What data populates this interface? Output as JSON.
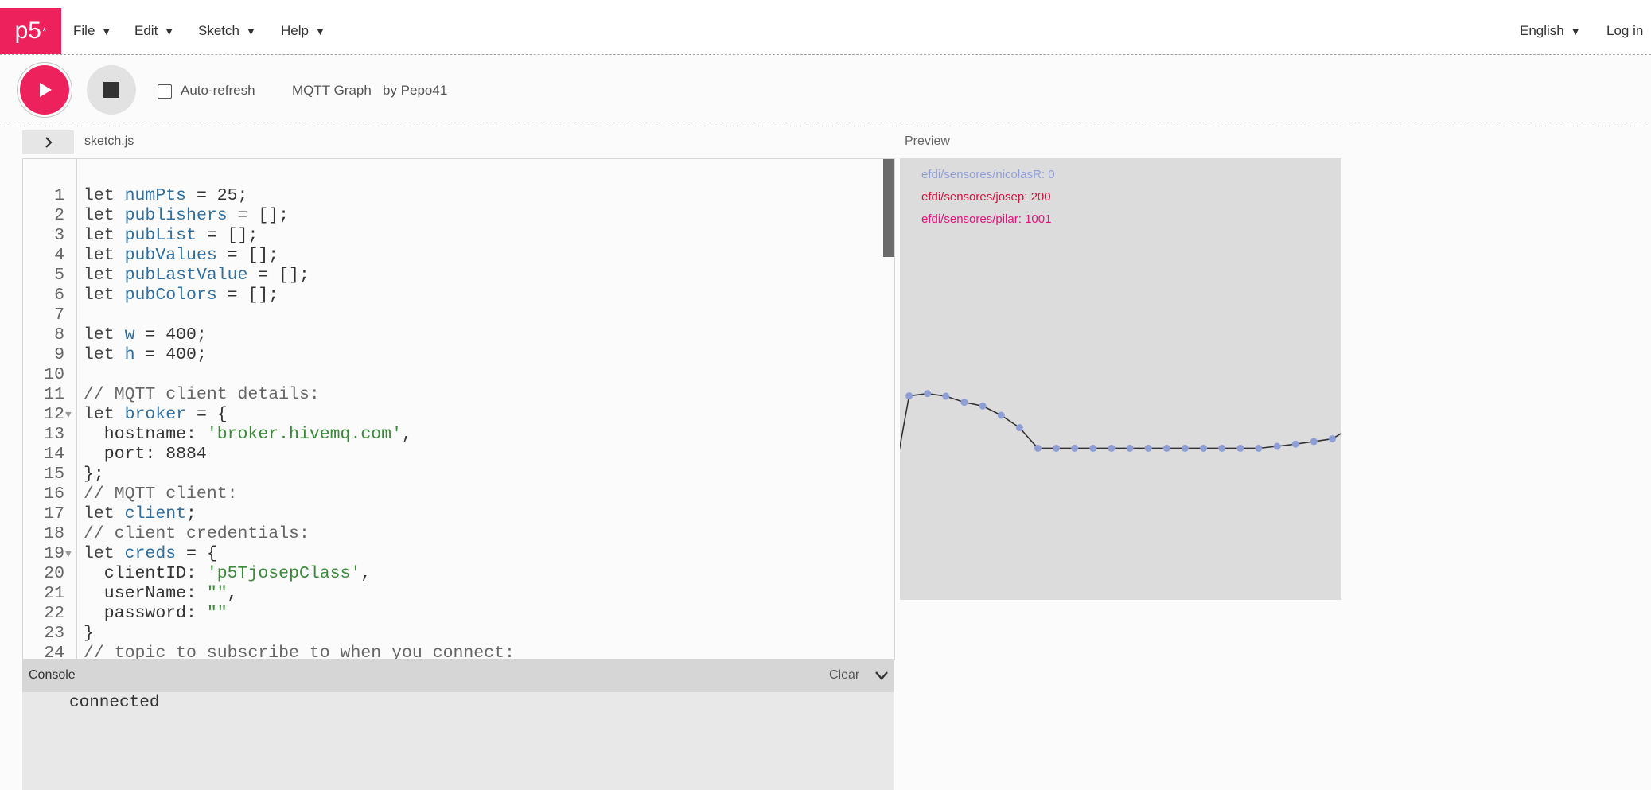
{
  "nav": {
    "logo": "p5",
    "logo_mark": "*",
    "menus": [
      {
        "label": "File"
      },
      {
        "label": "Edit"
      },
      {
        "label": "Sketch"
      },
      {
        "label": "Help"
      }
    ],
    "language": "English",
    "login": "Log in",
    "caret": "▼"
  },
  "toolbar": {
    "auto_refresh_label": "Auto-refresh",
    "auto_refresh_checked": false,
    "sketch_name": "MQTT Graph",
    "author": "by Pepo41"
  },
  "editor": {
    "file_tab": "sketch.js",
    "toggle_icon": "chevron-right-icon",
    "lines": [
      {
        "n": "1",
        "code": "let numPts = 25;"
      },
      {
        "n": "2",
        "code": "let publishers = [];"
      },
      {
        "n": "3",
        "code": "let pubList = [];"
      },
      {
        "n": "4",
        "code": "let pubValues = [];"
      },
      {
        "n": "5",
        "code": "let pubLastValue = [];"
      },
      {
        "n": "6",
        "code": "let pubColors = [];"
      },
      {
        "n": "7",
        "code": ""
      },
      {
        "n": "8",
        "code": "let w = 400;"
      },
      {
        "n": "9",
        "code": "let h = 400;"
      },
      {
        "n": "10",
        "code": ""
      },
      {
        "n": "11",
        "code": "// MQTT client details:"
      },
      {
        "n": "12",
        "code": "let broker = {",
        "fold": true
      },
      {
        "n": "13",
        "code": "  hostname: 'broker.hivemq.com',"
      },
      {
        "n": "14",
        "code": "  port: 8884"
      },
      {
        "n": "15",
        "code": "};"
      },
      {
        "n": "16",
        "code": "// MQTT client:"
      },
      {
        "n": "17",
        "code": "let client;"
      },
      {
        "n": "18",
        "code": "// client credentials:"
      },
      {
        "n": "19",
        "code": "let creds = {",
        "fold": true
      },
      {
        "n": "20",
        "code": "  clientID: 'p5TjosepClass',"
      },
      {
        "n": "21",
        "code": "  userName: \"\","
      },
      {
        "n": "22",
        "code": "  password: \"\""
      },
      {
        "n": "23",
        "code": "}"
      },
      {
        "n": "24",
        "code": "// topic to subscribe to when you connect:"
      }
    ]
  },
  "preview": {
    "label": "Preview",
    "legend": [
      {
        "text": "efdi/sensores/nicolasR: 0",
        "color": "#8f9fd6"
      },
      {
        "text": "efdi/sensores/josep: 200",
        "color": "#d6123e"
      },
      {
        "text": "efdi/sensores/pilar: 1001",
        "color": "#e6137a"
      }
    ],
    "line_color": "#333333",
    "point_color": "#8f9fd6",
    "series": [
      -120,
      152,
      158,
      151,
      135,
      125,
      100,
      67,
      12,
      12,
      12,
      12,
      12,
      12,
      12,
      12,
      12,
      12,
      12,
      12,
      12,
      17,
      23,
      30,
      37,
      67
    ]
  },
  "console": {
    "title": "Console",
    "clear_label": "Clear",
    "output": "connected"
  },
  "colors": {
    "accent": "#ed225d"
  }
}
